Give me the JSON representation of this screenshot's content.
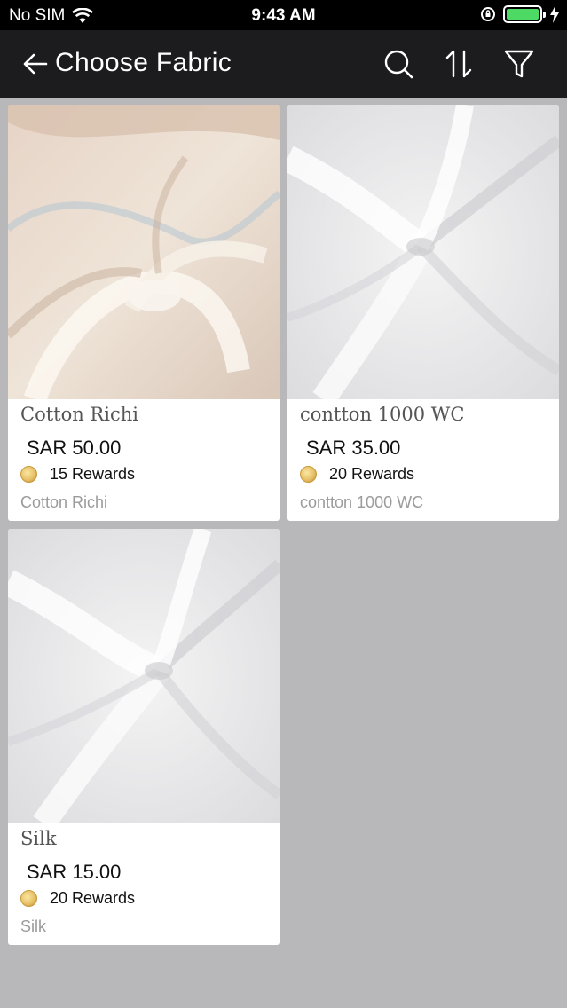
{
  "status_bar": {
    "carrier": "No SIM",
    "time": "9:43 AM"
  },
  "nav": {
    "title": "Choose Fabric"
  },
  "products": [
    {
      "name": "Cotton Richi",
      "price": "SAR 50.00",
      "rewards": "15 Rewards",
      "subtitle": "Cotton Richi",
      "image": "beige-fabric"
    },
    {
      "name": "contton 1000 WC",
      "price": "SAR 35.00",
      "rewards": "20 Rewards",
      "subtitle": "contton 1000 WC",
      "image": "white-silk"
    },
    {
      "name": "Silk",
      "price": "SAR 15.00",
      "rewards": "20 Rewards",
      "subtitle": "Silk",
      "image": "white-silk"
    }
  ],
  "colors": {
    "background": "#b8b7b9",
    "navbar": "#1c1c1e",
    "battery": "#4cd964"
  }
}
